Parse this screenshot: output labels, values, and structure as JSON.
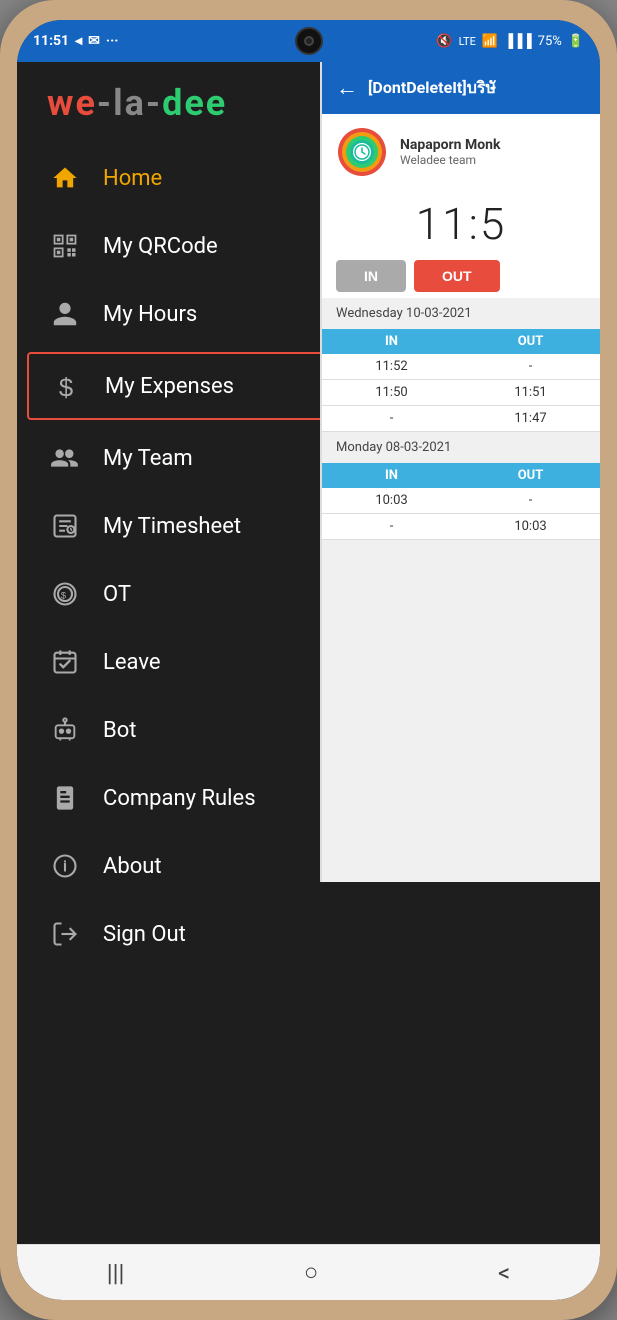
{
  "statusBar": {
    "time": "11:51",
    "battery": "75%",
    "icons": [
      "location",
      "mail",
      "menu-dots",
      "mute",
      "lte",
      "wifi",
      "signal"
    ]
  },
  "logo": {
    "we": "we",
    "dash1": "-",
    "la": "la",
    "dash2": "-",
    "dee": "dee"
  },
  "menu": {
    "items": [
      {
        "id": "home",
        "label": "Home",
        "icon": "home-icon",
        "active": false,
        "selected": false
      },
      {
        "id": "my-qrcode",
        "label": "My QRCode",
        "icon": "qrcode-icon",
        "active": false,
        "selected": false
      },
      {
        "id": "my-hours",
        "label": "My Hours",
        "icon": "person-icon",
        "active": false,
        "selected": false
      },
      {
        "id": "my-expenses",
        "label": "My Expenses",
        "icon": "dollar-icon",
        "active": false,
        "selected": true
      },
      {
        "id": "my-team",
        "label": "My Team",
        "icon": "team-icon",
        "active": false,
        "selected": false
      },
      {
        "id": "my-timesheet",
        "label": "My Timesheet",
        "icon": "timesheet-icon",
        "active": false,
        "selected": false
      },
      {
        "id": "ot",
        "label": "OT",
        "icon": "ot-icon",
        "active": false,
        "selected": false
      },
      {
        "id": "leave",
        "label": "Leave",
        "icon": "leave-icon",
        "active": false,
        "selected": false
      },
      {
        "id": "bot",
        "label": "Bot",
        "icon": "bot-icon",
        "active": false,
        "selected": false
      },
      {
        "id": "company-rules",
        "label": "Company Rules",
        "icon": "rules-icon",
        "active": false,
        "selected": false
      },
      {
        "id": "about",
        "label": "About",
        "icon": "about-icon",
        "active": false,
        "selected": false
      },
      {
        "id": "sign-out",
        "label": "Sign Out",
        "icon": "signout-icon",
        "active": false,
        "selected": false
      }
    ]
  },
  "rightPanel": {
    "backLabel": "←",
    "title": "[DontDeleteIt]บริษั",
    "profileName": "Napaporn Monk",
    "profileTeam": "Weladee team",
    "currentTime": "11:5",
    "btnIn": "IN",
    "btnOut": "OUT",
    "attendance": {
      "wednesday": {
        "date": "Wednesday 10-03-2021",
        "headers": [
          "IN",
          "OUT"
        ],
        "rows": [
          {
            "in": "11:52",
            "out": "-"
          },
          {
            "in": "11:50",
            "out": "11:51"
          },
          {
            "in": "-",
            "out": "11:47"
          }
        ]
      },
      "monday": {
        "date": "Monday 08-03-2021",
        "headers": [
          "IN",
          "OUT"
        ],
        "rows": [
          {
            "in": "10:03",
            "out": "-"
          },
          {
            "in": "-",
            "out": "10:03"
          }
        ]
      }
    }
  },
  "bottomNav": {
    "buttons": [
      "|||",
      "○",
      "<"
    ]
  }
}
